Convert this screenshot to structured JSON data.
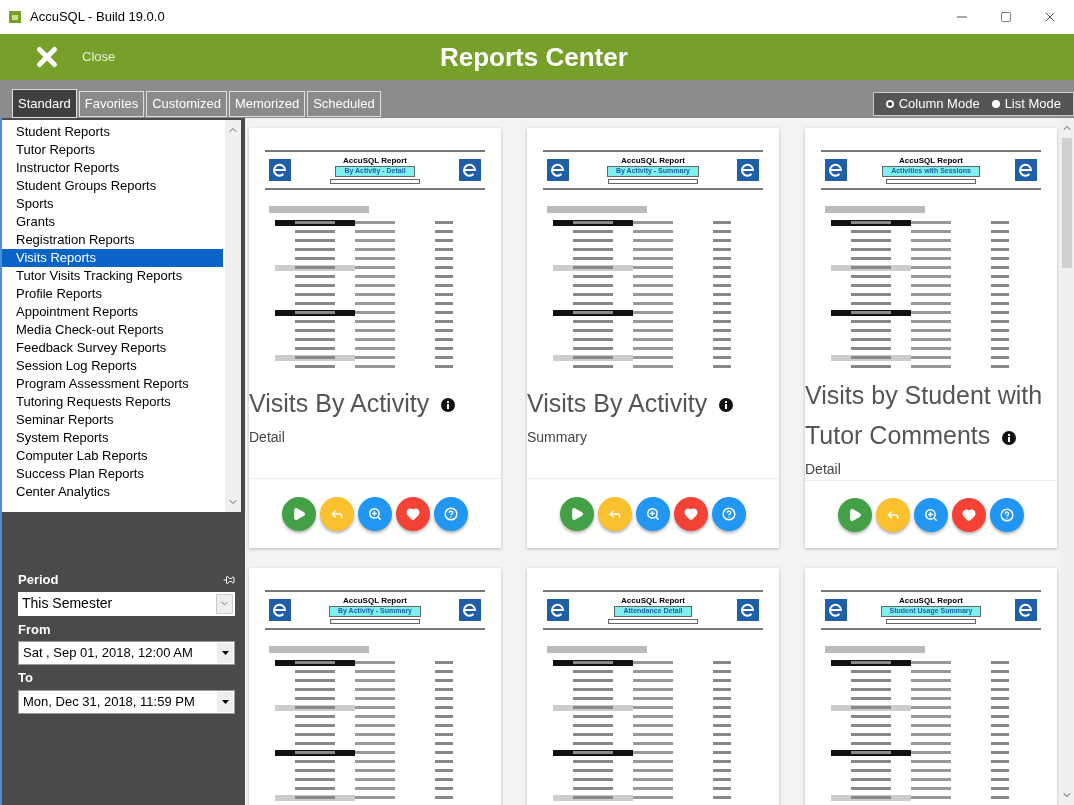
{
  "window": {
    "title": "AccuSQL - Build 19.0.0"
  },
  "header": {
    "close_label": "Close",
    "title": "Reports Center"
  },
  "tabs": [
    {
      "label": "Standard",
      "selected": true
    },
    {
      "label": "Favorites",
      "selected": false
    },
    {
      "label": "Customized",
      "selected": false
    },
    {
      "label": "Memorized",
      "selected": false
    },
    {
      "label": "Scheduled",
      "selected": false
    }
  ],
  "view_modes": [
    {
      "label": "Column Mode",
      "selected": true
    },
    {
      "label": "List Mode",
      "selected": false
    }
  ],
  "categories": [
    {
      "label": "Student Reports",
      "selected": false
    },
    {
      "label": "Tutor Reports",
      "selected": false
    },
    {
      "label": "Instructor Reports",
      "selected": false
    },
    {
      "label": "Student Groups Reports",
      "selected": false
    },
    {
      "label": "Sports",
      "selected": false
    },
    {
      "label": "Grants",
      "selected": false
    },
    {
      "label": "Registration Reports",
      "selected": false
    },
    {
      "label": "Visits Reports",
      "selected": true
    },
    {
      "label": "Tutor Visits Tracking Reports",
      "selected": false
    },
    {
      "label": "Profile Reports",
      "selected": false
    },
    {
      "label": "Appointment Reports",
      "selected": false
    },
    {
      "label": "Media Check-out Reports",
      "selected": false
    },
    {
      "label": "Feedback Survey Reports",
      "selected": false
    },
    {
      "label": "Session Log Reports",
      "selected": false
    },
    {
      "label": "Program Assessment Reports",
      "selected": false
    },
    {
      "label": "Tutoring Requests Reports",
      "selected": false
    },
    {
      "label": "Seminar Reports",
      "selected": false
    },
    {
      "label": "System Reports",
      "selected": false
    },
    {
      "label": "Computer Lab Reports",
      "selected": false
    },
    {
      "label": "Success Plan Reports",
      "selected": false
    },
    {
      "label": "Center Analytics",
      "selected": false
    }
  ],
  "filters": {
    "period_label": "Period",
    "period": "This Semester",
    "from_label": "From",
    "from": "Sat , Sep 01, 2018, 12:00 AM",
    "to_label": "To",
    "to": "Mon, Dec 31, 2018, 11:59 PM"
  },
  "reports": [
    {
      "preview": {
        "heading": "AccuSQL Report",
        "subtitle": "By Activity - Detail"
      },
      "title": "Visits By Activity",
      "subtitle": "Detail"
    },
    {
      "preview": {
        "heading": "AccuSQL Report",
        "subtitle": "By Activity - Summary"
      },
      "title": "Visits By Activity",
      "subtitle": "Summary"
    },
    {
      "preview": {
        "heading": "AccuSQL Report",
        "subtitle": "Activities with Sessions"
      },
      "title": "Visits by Student with Tutor Comments",
      "subtitle": "Detail"
    },
    {
      "preview": {
        "heading": "AccuSQL Report",
        "subtitle": "By Activity - Summary"
      }
    },
    {
      "preview": {
        "heading": "AccuSQL Report",
        "subtitle": "Attendance Detail"
      }
    },
    {
      "preview": {
        "heading": "AccuSQL Report",
        "subtitle": "Student Usage Summary"
      }
    }
  ]
}
